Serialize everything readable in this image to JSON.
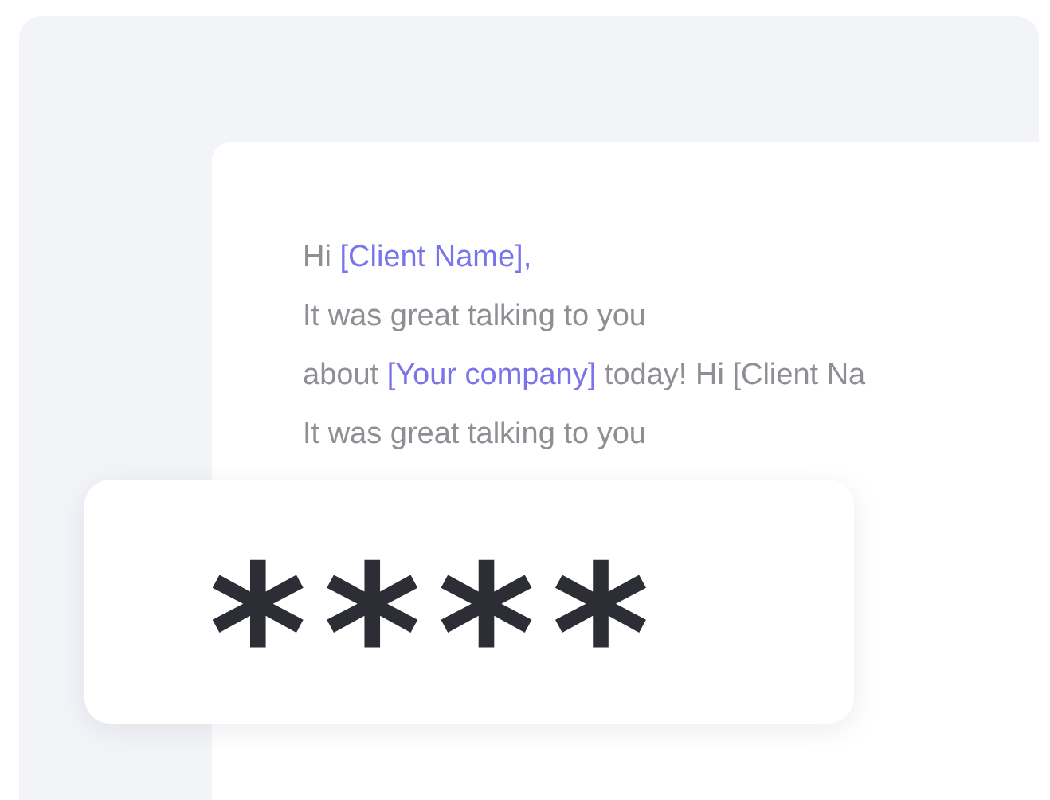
{
  "message": {
    "lines": [
      [
        {
          "kind": "plain",
          "text": "Hi "
        },
        {
          "kind": "placeholder",
          "text": "[Client Name],"
        }
      ],
      [
        {
          "kind": "plain",
          "text": "It was great talking to you"
        }
      ],
      [
        {
          "kind": "plain",
          "text": "about "
        },
        {
          "kind": "placeholder",
          "text": "[Your company]"
        },
        {
          "kind": "plain",
          "text": " today! Hi [Client Na"
        }
      ],
      [
        {
          "kind": "plain",
          "text": "It was great talking to you"
        }
      ]
    ]
  },
  "password": {
    "mask": "****"
  }
}
